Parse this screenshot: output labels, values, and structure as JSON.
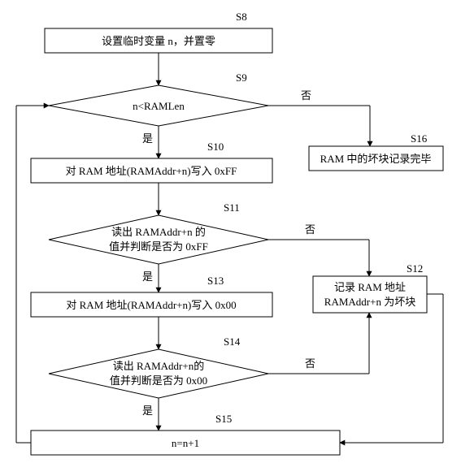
{
  "labels": {
    "s8": "S8",
    "s9": "S9",
    "s10": "S10",
    "s11": "S11",
    "s12": "S12",
    "s13": "S13",
    "s14": "S14",
    "s15": "S15",
    "s16": "S16",
    "yes": "是",
    "no": "否"
  },
  "nodes": {
    "s8": "设置临时变量 n，并置零",
    "s9": "n<RAMLen",
    "s10": "对 RAM 地址(RAMAddr+n)写入 0xFF",
    "s16": "RAM 中的坏块记录完毕",
    "s11_l1": "读出 RAMAddr+n 的",
    "s11_l2": "值并判断是否为 0xFF",
    "s13": "对 RAM 地址(RAMAddr+n)写入 0x00",
    "s12_l1": "记录 RAM 地址",
    "s12_l2": "RAMAddr+n 为坏块",
    "s14_l1": "读出 RAMAddr+n的",
    "s14_l2": "值并判断是否为 0x00",
    "s15": "n=n+1"
  }
}
